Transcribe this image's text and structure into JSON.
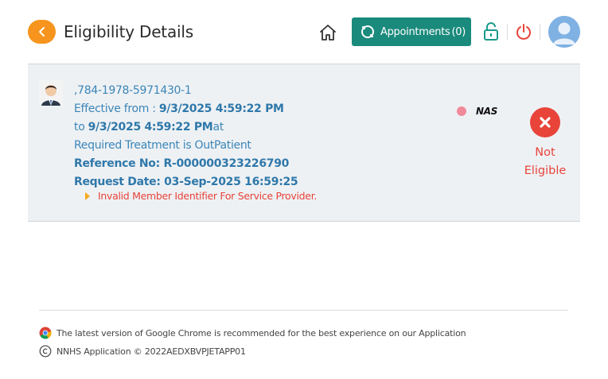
{
  "header": {
    "title": "Eligibility Details",
    "appointments_label": "Appointments",
    "appointments_count": "(0)"
  },
  "member": {
    "id_line": ",784-1978-5971430-1",
    "effective_prefix": "Effective from : ",
    "effective_from": "9/3/2025 4:59:22 PM",
    "to_prefix": "to ",
    "effective_to": "9/3/2025 4:59:22 PM",
    "to_suffix": "at",
    "treatment": "Required Treatment is OutPatient",
    "reference": "Reference No: R-000000323226790",
    "request_date": "Request Date: 03-Sep-2025 16:59:25",
    "error_message": "Invalid Member Identifier For Service Provider."
  },
  "payer": {
    "name": "NAS"
  },
  "status": {
    "line1": "Not",
    "line2": "Eligible",
    "color": "#e8443a"
  },
  "footer": {
    "browser_note": "The latest version of Google Chrome is recommended for the best experience on our Application",
    "copyright": "NNHS Application © 2022AEDXBVPJETAPP01"
  },
  "colors": {
    "accent_orange": "#f7941d",
    "teal": "#1a8a7c",
    "link_blue": "#3b86b8",
    "error_red": "#e8443a"
  }
}
